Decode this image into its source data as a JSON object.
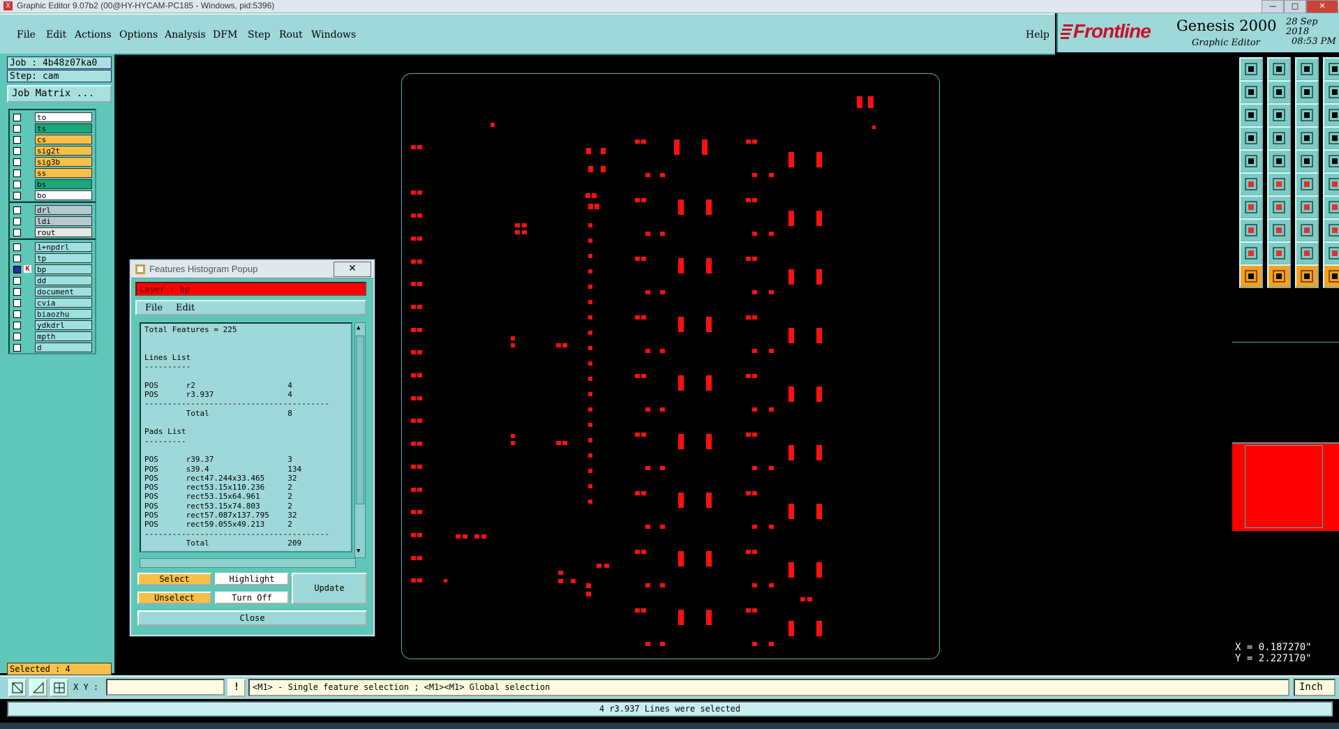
{
  "window": {
    "title": "Graphic Editor 9.07b2 (00@HY-HYCAM-PC185 - Windows, pid:5396)"
  },
  "menubar": {
    "items": [
      "File",
      "Edit",
      "Actions",
      "Options",
      "Analysis",
      "DFM",
      "Step",
      "Rout",
      "Windows"
    ],
    "help": "Help"
  },
  "brand": {
    "logo": "Frontline",
    "product": "Genesis 2000",
    "subtitle": "Graphic Editor",
    "date": "28 Sep 2018",
    "time": "08:53 PM"
  },
  "job": {
    "job_label": "Job : 4b48z07ka0",
    "step_label": "Step: cam",
    "matrix_button": "Job Matrix ..."
  },
  "layers": {
    "group1": [
      {
        "name": "to",
        "color": "#ffffff"
      },
      {
        "name": "ts",
        "color": "#1aa87a"
      },
      {
        "name": "cs",
        "color": "#f7c04a"
      },
      {
        "name": "sig2t",
        "color": "#f7c04a"
      },
      {
        "name": "sig3b",
        "color": "#f7c04a"
      },
      {
        "name": "ss",
        "color": "#f7c04a"
      },
      {
        "name": "bs",
        "color": "#1aa87a"
      },
      {
        "name": "bo",
        "color": "#ffffff"
      }
    ],
    "group2": [
      {
        "name": "drl",
        "color": "#b8c8d0"
      },
      {
        "name": "ldi",
        "color": "#b8c8d0"
      },
      {
        "name": "rout",
        "color": "#e8e8e8"
      }
    ],
    "group3": [
      {
        "name": "1+npdrl",
        "color": "#9fe0e0"
      },
      {
        "name": "tp",
        "color": "#9fe0e0"
      },
      {
        "name": "bp",
        "color": "#9fe0e0",
        "work": true
      },
      {
        "name": "dd",
        "color": "#9fe0e0"
      },
      {
        "name": "document",
        "color": "#9fe0e0"
      },
      {
        "name": "cvia",
        "color": "#9fe0e0"
      },
      {
        "name": "biaozhu",
        "color": "#9fe0e0"
      },
      {
        "name": "ydkdrl",
        "color": "#9fe0e0"
      },
      {
        "name": "mpth",
        "color": "#9fe0e0"
      },
      {
        "name": "d",
        "color": "#9fe0e0"
      }
    ]
  },
  "selected": "Selected : 4",
  "popup": {
    "title": "Features Histogram Popup",
    "layer": "Layer :  bp",
    "menu": {
      "file": "File",
      "edit": "Edit"
    },
    "report": [
      "Total Features = 225",
      "",
      "",
      "Lines List",
      "----------",
      "",
      "POS      r2                    4",
      "POS      r3.937                4",
      "----------------------------------------",
      "         Total                 8",
      "",
      "Pads List",
      "---------",
      "",
      "POS      r39.37                3",
      "POS      s39.4                 134",
      "POS      rect47.244x33.465     32",
      "POS      rect53.15x110.236     2",
      "POS      rect53.15x64.961      2",
      "POS      rect53.15x74.803      2",
      "POS      rect57.087x137.795    32",
      "POS      rect59.055x49.213     2",
      "----------------------------------------",
      "         Total                 209"
    ],
    "buttons": {
      "select": "Select",
      "highlight": "Highlight",
      "unselect": "Unselect",
      "turn_off": "Turn Off",
      "update": "Update",
      "close": "Close"
    }
  },
  "coords": {
    "x": "X = 0.187270\"",
    "y": "Y = 2.227170\""
  },
  "cmdbar": {
    "xy_label": "X Y :",
    "xy_value": "",
    "warn": "!",
    "hint": "<M1> - Single feature selection ; <M1><M1> Global selection",
    "units": "Inch"
  },
  "status": "4 r3.937 Lines were selected",
  "colors": {
    "pad": "#ff1010",
    "accent": "#9fd8d8",
    "panel": "#5fc7b8",
    "board_outline": "#4fb3b3"
  }
}
